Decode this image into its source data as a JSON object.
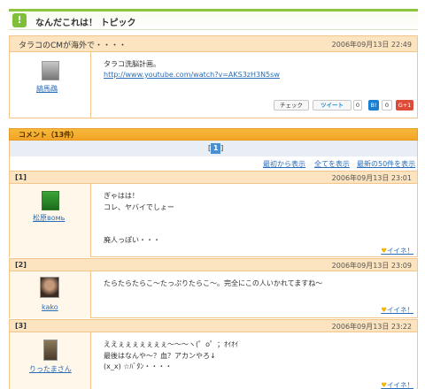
{
  "header": {
    "icon": "!",
    "title": "なんだこれは！ トピック"
  },
  "topic": {
    "title": "タラコのCMが海外で・・・・",
    "date": "2006年09月13日 22:49",
    "user": "縞馬鵡",
    "lines": [
      "タラコ洗脳計画。"
    ],
    "link": "http://www.youtube.com/watch?v=AKS3zH3N5sw",
    "share": {
      "check": "チェック",
      "tweet": "ツイート",
      "tweet_count": "0",
      "hatena": "B!",
      "hatena_count": "0",
      "gplus": "G+1"
    }
  },
  "comments_header": "コメント（13件）",
  "pager": {
    "open": "[",
    "current": "1",
    "close": "]"
  },
  "nav": {
    "first": "最初から表示",
    "all": "全てを表示",
    "latest": "最新の50件を表示"
  },
  "iine_label": "イイネ！",
  "comments": [
    {
      "num": "[1]",
      "date": "2006年09月13日 23:01",
      "user": "松原вомь",
      "text": "ぎゃはは！\nコレ、ヤバイでしょー\n\n\n廃人っぽい・・・"
    },
    {
      "num": "[2]",
      "date": "2006年09月13日 23:09",
      "user": "kako",
      "text": "たらたらたらこ〜たっぷりたらこ〜。完全にこの人いかれてますね〜"
    },
    {
      "num": "[3]",
      "date": "2006年09月13日 23:22",
      "user": "りったまさん",
      "text": "ええぇぇぇぇぇぇぇ〜〜〜ヽ(゜o゜；ｵｲｵｲ\n最後はなんや〜？血？アカンやろ↓\n(x_x) ☆ﾊﾞﾀﾝ・・・・"
    }
  ],
  "colors": {
    "accent_green": "#8cc63e",
    "orange": "#f3a326",
    "link": "#2a6db8"
  }
}
